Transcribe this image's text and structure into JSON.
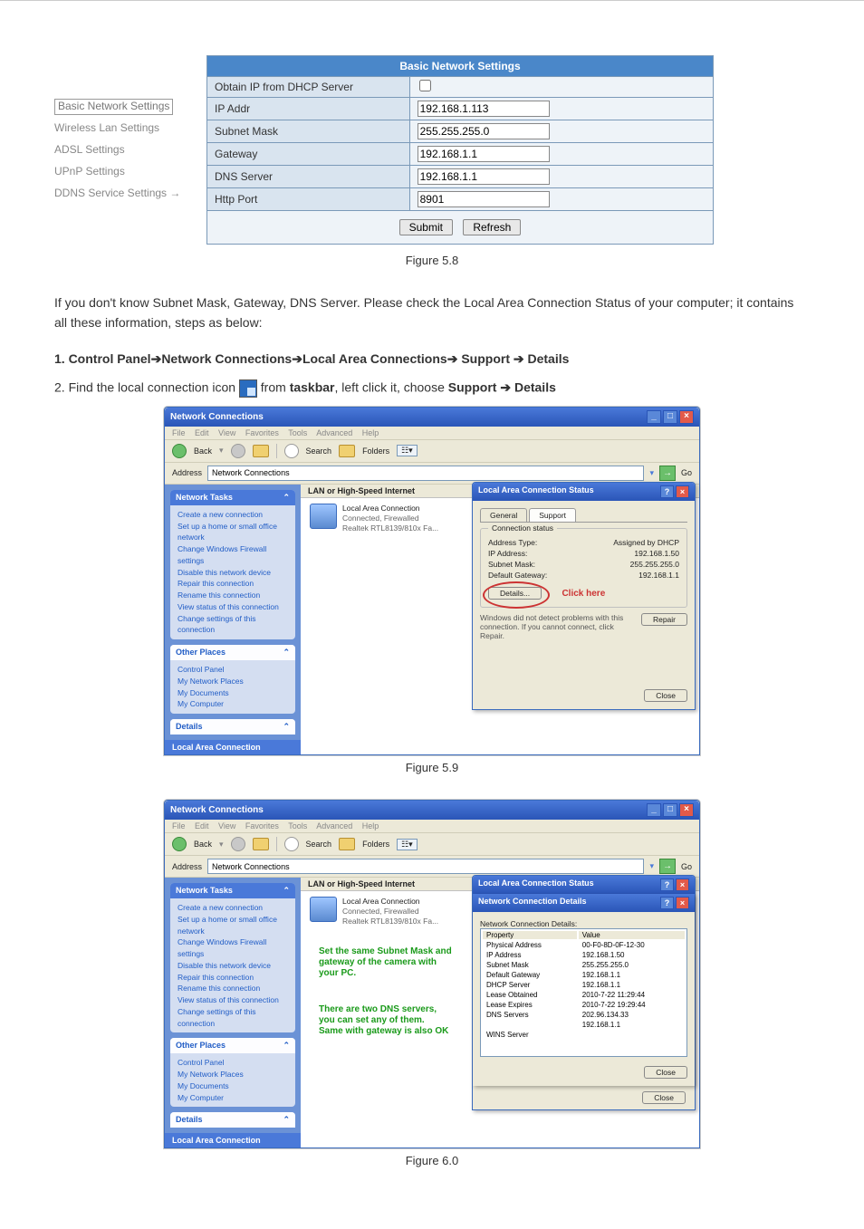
{
  "settings_table": {
    "title": "Basic Network Settings",
    "rows": {
      "dhcp_label": "Obtain IP from DHCP Server",
      "ip_label": "IP Addr",
      "ip_value": "192.168.1.113",
      "mask_label": "Subnet Mask",
      "mask_value": "255.255.255.0",
      "gw_label": "Gateway",
      "gw_value": "192.168.1.1",
      "dns_label": "DNS Server",
      "dns_value": "192.168.1.1",
      "port_label": "Http Port",
      "port_value": "8901"
    },
    "buttons": {
      "submit": "Submit",
      "refresh": "Refresh"
    }
  },
  "sidebar": {
    "items": [
      "Basic Network Settings",
      "Wireless Lan Settings",
      "ADSL Settings",
      "UPnP Settings",
      "DDNS Service Settings"
    ]
  },
  "captions": {
    "fig58": "Figure 5.8",
    "fig59": "Figure 5.9",
    "fig60": "Figure 6.0"
  },
  "para1": "If you don't know Subnet Mask, Gateway, DNS Server. Please check the Local Area Connection Status of your computer; it contains all these information, steps as below:",
  "step1": {
    "prefix": "1. Control Panel",
    "b": "Network Connections",
    "c": "Local Area Connections",
    "d": "Support",
    "e": "Details"
  },
  "step2": {
    "a": "2. Find the local connection icon",
    "b": "from",
    "c": "taskbar",
    "d": ", left click it, choose",
    "e": "Support",
    "f": "Details"
  },
  "xp": {
    "title": "Network Connections",
    "menubar": "File Edit View Favorites Tools Advanced Help",
    "back": "Back",
    "search": "Search",
    "folders": "Folders",
    "address_label": "Address",
    "address_value": "Network Connections",
    "go": "Go",
    "col_hdr": "LAN or High-Speed Internet",
    "conn_name": "Local Area Connection",
    "conn_status": "Connected, Firewalled",
    "conn_nic": "Realtek RTL8139/810x Fa...",
    "side": {
      "tasks_title": "Network Tasks",
      "tasks": [
        "Create a new connection",
        "Set up a home or small office network",
        "Change Windows Firewall settings",
        "Disable this network device",
        "Repair this connection",
        "Rename this connection",
        "View status of this connection",
        "Change settings of this connection"
      ],
      "other_title": "Other Places",
      "other": [
        "Control Panel",
        "My Network Places",
        "My Documents",
        "My Computer"
      ],
      "details_title": "Details",
      "details_sub": "Local Area Connection"
    }
  },
  "dlg59": {
    "title": "Local Area Connection Status",
    "tab_general": "General",
    "tab_support": "Support",
    "group": "Connection status",
    "addr_type_l": "Address Type:",
    "addr_type_v": "Assigned by DHCP",
    "ip_l": "IP Address:",
    "ip_v": "192.168.1.50",
    "mask_l": "Subnet Mask:",
    "mask_v": "255.255.255.0",
    "gw_l": "Default Gateway:",
    "gw_v": "192.168.1.1",
    "details": "Details...",
    "note": "Windows did not detect problems with this connection. If you cannot connect, click Repair.",
    "repair": "Repair",
    "close": "Close",
    "annot": "Click here"
  },
  "dlg60": {
    "title": "Local Area Connection Status",
    "sub_title": "Network Connection Details",
    "sub_label": "Network Connection Details:",
    "hdr_prop": "Property",
    "hdr_val": "Value",
    "rows": [
      [
        "Physical Address",
        "00-F0-8D-0F-12-30"
      ],
      [
        "IP Address",
        "192.168.1.50"
      ],
      [
        "Subnet Mask",
        "255.255.255.0"
      ],
      [
        "Default Gateway",
        "192.168.1.1"
      ],
      [
        "DHCP Server",
        "192.168.1.1"
      ],
      [
        "Lease Obtained",
        "2010-7-22 11:29:44"
      ],
      [
        "Lease Expires",
        "2010-7-22 19:29:44"
      ],
      [
        "DNS Servers",
        "202.96.134.33"
      ],
      [
        "",
        "192.168.1.1"
      ],
      [
        "WINS Server",
        ""
      ]
    ],
    "close": "Close",
    "annot1a": "Set the same Subnet Mask and",
    "annot1b": "gateway of the camera with",
    "annot1c": "your PC.",
    "annot2a": "There are two DNS servers,",
    "annot2b": "you can set any of them.",
    "annot2c": "Same with gateway is also OK"
  }
}
